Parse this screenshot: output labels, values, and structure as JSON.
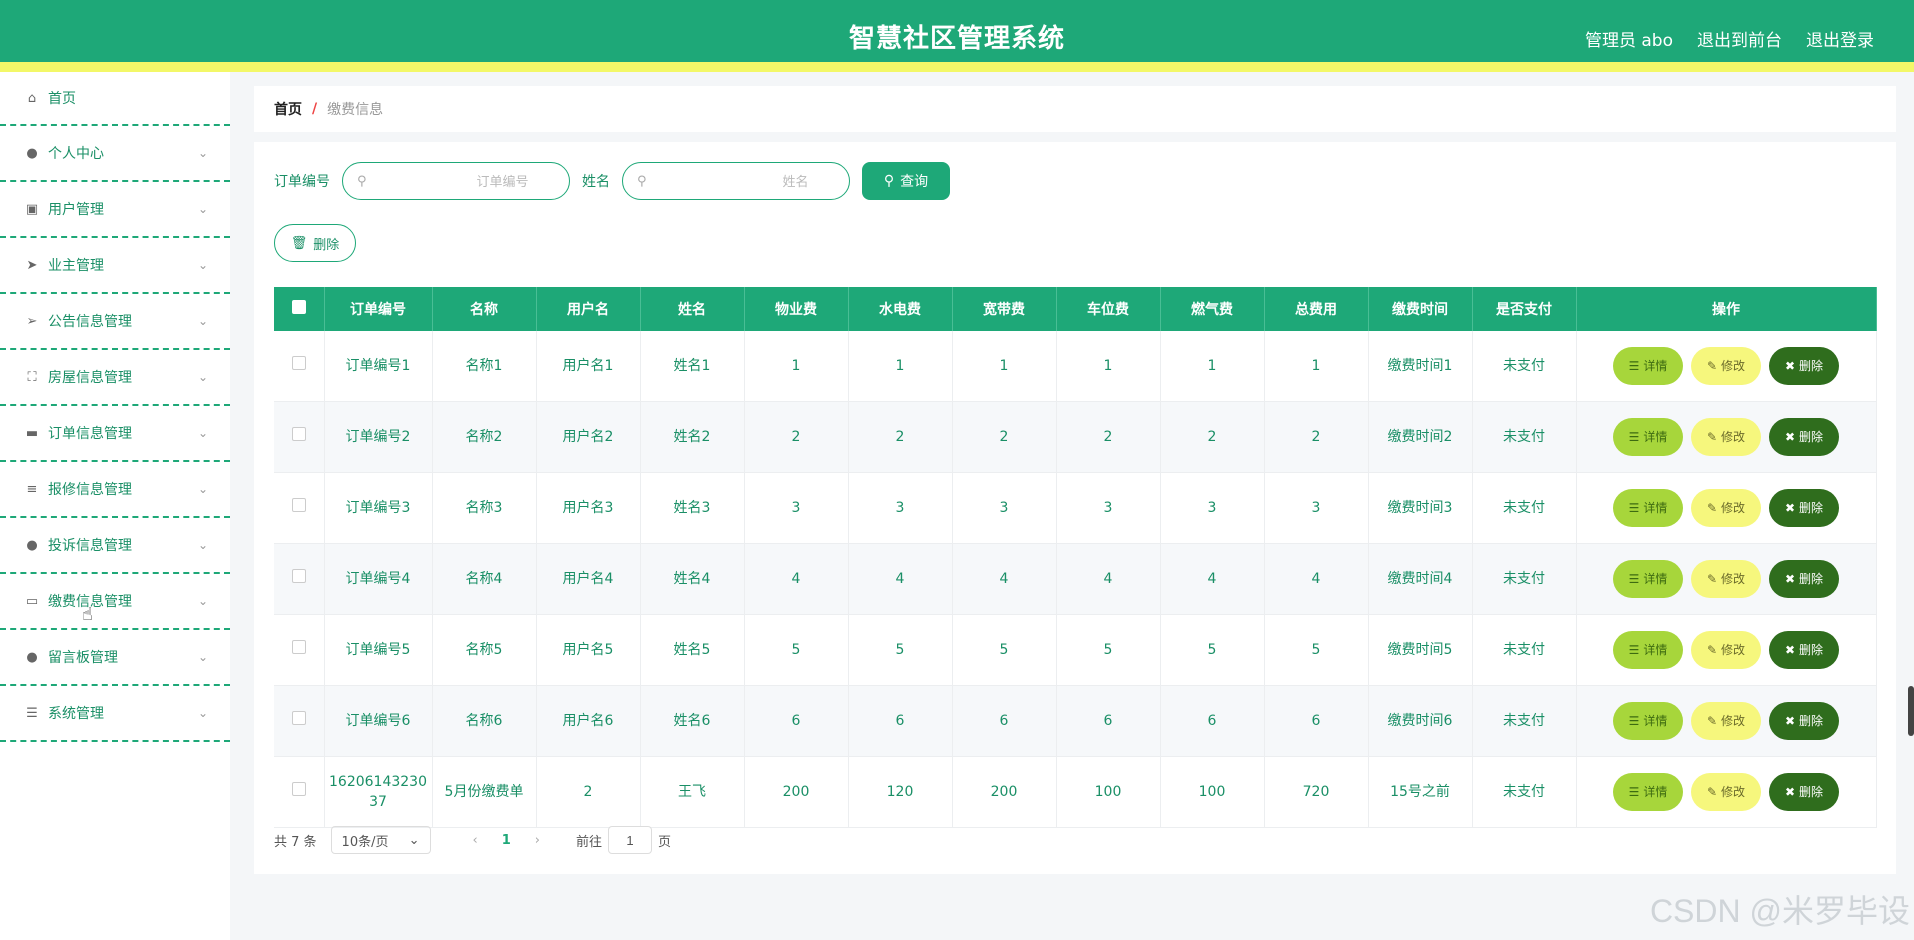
{
  "header": {
    "title": "智慧社区管理系统",
    "admin": "管理员 abo",
    "to_front": "退出到前台",
    "logout": "退出登录"
  },
  "sidebar": {
    "items": [
      {
        "label": "首页",
        "icon": "home-icon",
        "glyph": "⌂",
        "chevron": false
      },
      {
        "label": "个人中心",
        "icon": "user-icon",
        "glyph": "●",
        "chevron": true
      },
      {
        "label": "用户管理",
        "icon": "clipboard-icon",
        "glyph": "▣",
        "chevron": true
      },
      {
        "label": "业主管理",
        "icon": "send-icon",
        "glyph": "➤",
        "chevron": true
      },
      {
        "label": "公告信息管理",
        "icon": "paper-plane-icon",
        "glyph": "➢",
        "chevron": true
      },
      {
        "label": "房屋信息管理",
        "icon": "frame-icon",
        "glyph": "⛶",
        "chevron": true
      },
      {
        "label": "订单信息管理",
        "icon": "ticket-icon",
        "glyph": "▬",
        "chevron": true
      },
      {
        "label": "报修信息管理",
        "icon": "sliders-icon",
        "glyph": "≡",
        "chevron": true
      },
      {
        "label": "投诉信息管理",
        "icon": "bulb-icon",
        "glyph": "●",
        "chevron": true
      },
      {
        "label": "缴费信息管理",
        "icon": "chat-icon",
        "glyph": "▭",
        "chevron": true
      },
      {
        "label": "留言板管理",
        "icon": "user-icon",
        "glyph": "●",
        "chevron": true
      },
      {
        "label": "系统管理",
        "icon": "menu-icon",
        "glyph": "☰",
        "chevron": true
      }
    ]
  },
  "breadcrumb": {
    "home": "首页",
    "sep": "/",
    "current": "缴费信息"
  },
  "search": {
    "order_label": "订单编号",
    "order_placeholder": "订单编号",
    "name_label": "姓名",
    "name_placeholder": "姓名",
    "query_label": "查询",
    "delete_label": "删除"
  },
  "table": {
    "headers": [
      "订单编号",
      "名称",
      "用户名",
      "姓名",
      "物业费",
      "水电费",
      "宽带费",
      "车位费",
      "燃气费",
      "总费用",
      "缴费时间",
      "是否支付",
      "操作"
    ],
    "rows": [
      [
        "订单编号1",
        "名称1",
        "用户名1",
        "姓名1",
        "1",
        "1",
        "1",
        "1",
        "1",
        "1",
        "缴费时间1",
        "未支付"
      ],
      [
        "订单编号2",
        "名称2",
        "用户名2",
        "姓名2",
        "2",
        "2",
        "2",
        "2",
        "2",
        "2",
        "缴费时间2",
        "未支付"
      ],
      [
        "订单编号3",
        "名称3",
        "用户名3",
        "姓名3",
        "3",
        "3",
        "3",
        "3",
        "3",
        "3",
        "缴费时间3",
        "未支付"
      ],
      [
        "订单编号4",
        "名称4",
        "用户名4",
        "姓名4",
        "4",
        "4",
        "4",
        "4",
        "4",
        "4",
        "缴费时间4",
        "未支付"
      ],
      [
        "订单编号5",
        "名称5",
        "用户名5",
        "姓名5",
        "5",
        "5",
        "5",
        "5",
        "5",
        "5",
        "缴费时间5",
        "未支付"
      ],
      [
        "订单编号6",
        "名称6",
        "用户名6",
        "姓名6",
        "6",
        "6",
        "6",
        "6",
        "6",
        "6",
        "缴费时间6",
        "未支付"
      ],
      [
        "1620614323037",
        "5月份缴费单",
        "2",
        "王飞",
        "200",
        "120",
        "200",
        "100",
        "100",
        "720",
        "15号之前",
        "未支付"
      ]
    ],
    "actions": {
      "detail": "详情",
      "edit": "修改",
      "delete": "删除"
    }
  },
  "pagination": {
    "total": "共 7 条",
    "page_size": "10条/页",
    "current_page": "1",
    "goto_prefix": "前往",
    "goto_value": "1",
    "goto_suffix": "页"
  },
  "watermark": "CSDN @米罗毕设",
  "colors": {
    "primary": "#1ea878",
    "header_stripe": "#f3f868",
    "detail_btn": "#a7d63b",
    "edit_btn": "#f6f77d",
    "delete_btn": "#2f6d1d"
  }
}
